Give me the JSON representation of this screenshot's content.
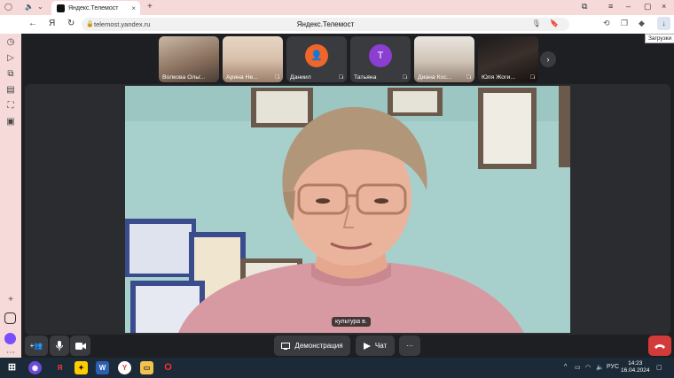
{
  "browser": {
    "tab_title": "Яндекс.Телемост",
    "url": "telemost.yandex.ru",
    "page_title": "Яндекс.Телемост",
    "tooltip": "Загрузки"
  },
  "participants": [
    {
      "name": "Волкова Ольг...",
      "muted": false
    },
    {
      "name": "Арина Не...",
      "muted": true
    },
    {
      "name": "Даниил",
      "muted": true,
      "avatar_color": "#f0662a"
    },
    {
      "name": "Татьяна",
      "muted": true,
      "avatar_letter": "Т",
      "avatar_color": "#8a3fd1"
    },
    {
      "name": "Диана Кос...",
      "muted": true
    },
    {
      "name": "Юля Жоги...",
      "muted": true
    }
  ],
  "speaker": {
    "label": "культура в."
  },
  "controls": {
    "demo_label": "Демонстрация",
    "chat_label": "Чат",
    "more_label": "···"
  },
  "taskbar": {
    "lang": "РУС",
    "time": "14:23",
    "date": "16.04.2024"
  },
  "colors": {
    "hangup": "#d33a3a",
    "app_bg": "#1e1f22"
  }
}
